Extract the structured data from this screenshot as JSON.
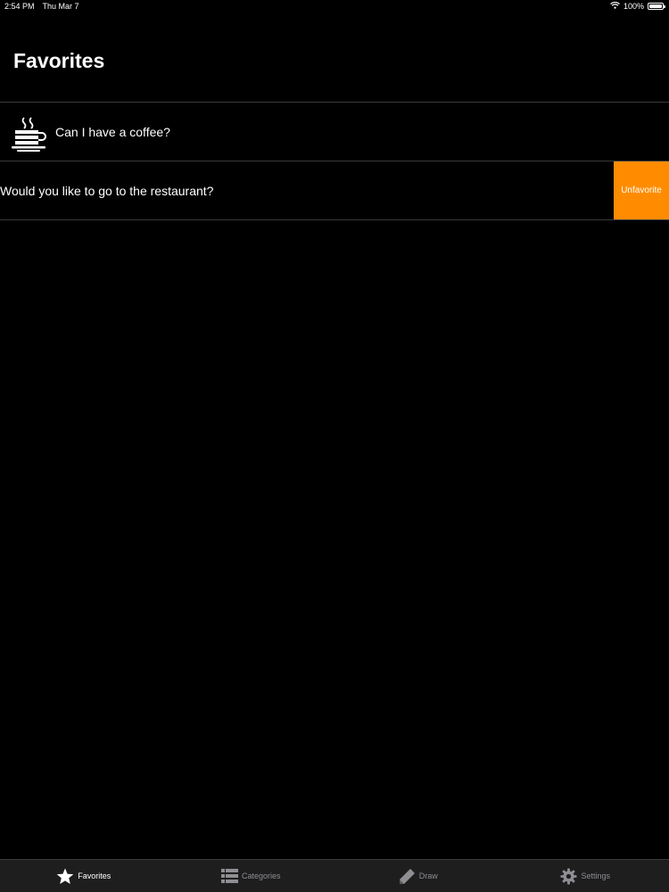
{
  "status_bar": {
    "time": "2:54 PM",
    "date": "Thu Mar 7",
    "battery": "100%"
  },
  "header": {
    "title": "Favorites"
  },
  "favorites": [
    {
      "text": "Can I have a coffee?",
      "icon": "coffee-cup-icon"
    },
    {
      "text": "Would you like to go to the restaurant?",
      "action": "Unfavorite"
    }
  ],
  "tabs": [
    {
      "label": "Favorites",
      "icon": "star-icon",
      "active": true
    },
    {
      "label": "Categories",
      "icon": "list-icon",
      "active": false
    },
    {
      "label": "Draw",
      "icon": "pencil-icon",
      "active": false
    },
    {
      "label": "Settings",
      "icon": "gear-icon",
      "active": false
    }
  ],
  "colors": {
    "background": "#000000",
    "accent": "#ff8c00",
    "tab_bar": "#1e1e1f",
    "inactive_tab": "#8e8e93",
    "separator": "#3a3a3c"
  }
}
